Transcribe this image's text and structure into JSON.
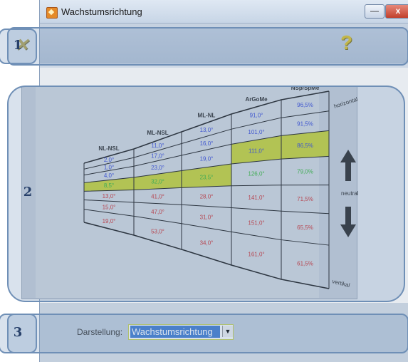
{
  "window": {
    "title": "Wachstumsrichtung",
    "min_label": "—",
    "close_label": "x"
  },
  "toolbar": {
    "close_icon": "x-icon",
    "help_icon": "help-icon",
    "help_glyph": "?"
  },
  "callouts": {
    "one": "1",
    "two": "2",
    "three": "3"
  },
  "chart": {
    "columns": [
      "NL-NSL",
      "ML-NSL",
      "ML-NL",
      "ArGoMe",
      "NSp/SpMe"
    ],
    "side_labels": {
      "top": "horizontal",
      "middle": "neutral",
      "bottom": "vertikal"
    },
    "rows": {
      "h4": [
        "2,0°",
        "11,0°",
        "13,0°",
        "91,0°",
        "96,5%"
      ],
      "h3": [
        "1,0°",
        "17,0°",
        "16,0°",
        "101,0°",
        "91,5%"
      ],
      "h2": [
        "4,0°",
        "23,0°",
        "19,0°",
        "111,0°",
        "86,5%"
      ],
      "n": [
        "8,5°",
        "32,0°",
        "23,5°",
        "126,0°",
        "79,0%"
      ],
      "v2": [
        "13,0°",
        "41,0°",
        "28,0°",
        "141,0°",
        "71,5%"
      ],
      "v3": [
        "15,0°",
        "47,0°",
        "31,0°",
        "151,0°",
        "65,5%"
      ],
      "v4": [
        "19,0°",
        "53,0°",
        "34,0°",
        "161,0°",
        "61,5%"
      ]
    },
    "colors": {
      "blue": "#2b3fd6",
      "green": "#2fb52f",
      "red": "#cf2a2a",
      "highlight": "#c9d42c"
    }
  },
  "footer": {
    "label": "Darstellung:",
    "select_value": "Wachstumsrichtung",
    "arrow": "▼"
  }
}
